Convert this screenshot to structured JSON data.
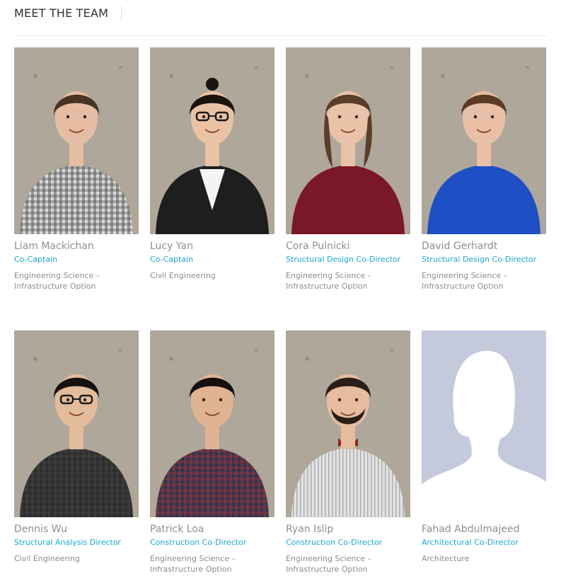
{
  "header": {
    "title": "MEET THE TEAM"
  },
  "members": [
    {
      "name": "Liam Mackichan",
      "role": "Co-Captain",
      "program": "Engineering Science – Infrastructure Option",
      "colors": {
        "shirt": "#d9d9d9",
        "hair": "#4a3322",
        "skin": "#e6bda3",
        "accent": "#444444"
      }
    },
    {
      "name": "Lucy Yan",
      "role": "Co-Captain",
      "program": "Civil Engineering",
      "colors": {
        "shirt": "#1e1e1e",
        "hair": "#1a1410",
        "skin": "#eac2a4",
        "accent": "#f2f2f2"
      }
    },
    {
      "name": "Cora Pulnicki",
      "role": "Structural Design Co-Director",
      "program": "Engineering Science - Infrastructure Option",
      "colors": {
        "shirt": "#7a1828",
        "hair": "#5a3d2a",
        "skin": "#e9c3a8",
        "accent": "#7a1828"
      }
    },
    {
      "name": "David Gerhardt",
      "role": "Structural Design Co-Director",
      "program": "Engineering Science – Infrastructure Option",
      "colors": {
        "shirt": "#1f4fc4",
        "hair": "#5b3b22",
        "skin": "#e9bfa5",
        "accent": "#1f4fc4"
      }
    },
    {
      "name": "Dennis Wu",
      "role": "Structural Analysis Director",
      "program": "Civil Engineering",
      "colors": {
        "shirt": "#2b2b2b",
        "hair": "#141110",
        "skin": "#e3bc9b",
        "accent": "#444444"
      }
    },
    {
      "name": "Patrick Loa",
      "role": "Construction Co-Director",
      "program": "Engineering Science – Infrastructure Option",
      "colors": {
        "shirt": "#2c3550",
        "hair": "#141110",
        "skin": "#e0b493",
        "accent": "#a33236"
      }
    },
    {
      "name": "Ryan Islip",
      "role": "Construction Co-Director",
      "program": "Engineering Science – Infrastructure Option",
      "colors": {
        "shirt": "#e2e2e2",
        "hair": "#2a1e16",
        "skin": "#e6bd9f",
        "accent": "#8b2a22"
      }
    },
    {
      "name": "Fahad Abdulmajeed",
      "role": "Architectural Co-Director",
      "program": "Architecture",
      "colors": {
        "shirt": "#ffffff",
        "hair": "#ffffff",
        "skin": "#ffffff",
        "accent": "#ffffff"
      }
    }
  ],
  "placeholder_background": "#c4c9dc",
  "photo_background": "#b8b0a3"
}
